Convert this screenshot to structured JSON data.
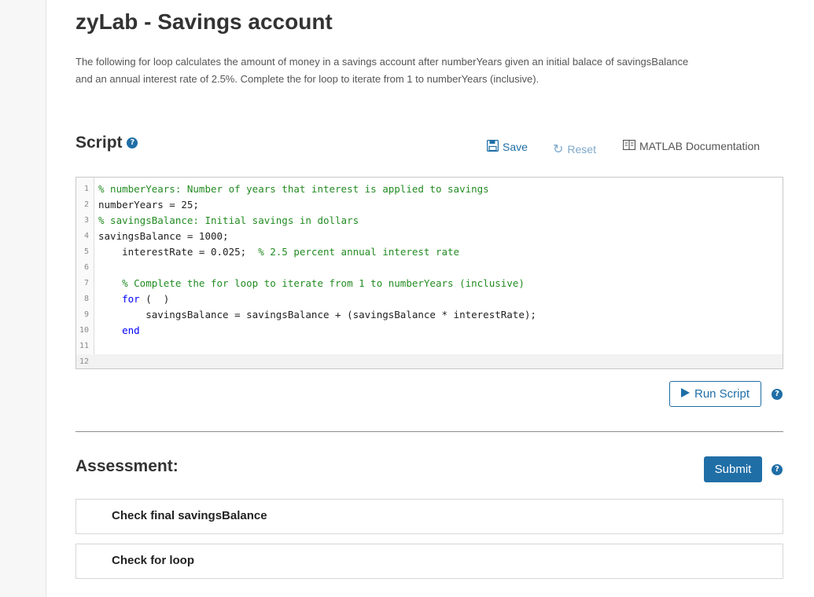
{
  "header": {
    "title": "zyLab - Savings account",
    "description_line1": "The following for loop calculates the amount of money in a savings account after numberYears given an initial balace of savingsBalance",
    "description_line2": "and an annual interest rate of 2.5%. Complete the for loop to iterate from 1 to numberYears (inclusive)."
  },
  "script_section": {
    "heading": "Script",
    "toolbar": {
      "save_label": "Save",
      "reset_label": "Reset",
      "docs_label": "MATLAB Documentation"
    }
  },
  "editor": {
    "lines": [
      {
        "num": "1",
        "text": "% numberYears: Number of years that interest is applied to savings"
      },
      {
        "num": "2",
        "text": "numberYears = 25;"
      },
      {
        "num": "3",
        "text": "% savingsBalance: Initial savings in dollars"
      },
      {
        "num": "4",
        "text": "savingsBalance = 1000;"
      },
      {
        "num": "5",
        "code": "    interestRate = 0.025;  ",
        "comment": "% 2.5 percent annual interest rate"
      },
      {
        "num": "6",
        "text": ""
      },
      {
        "num": "7",
        "text": "    % Complete the for loop to iterate from 1 to numberYears (inclusive)"
      },
      {
        "num": "8",
        "kw": "for",
        "rest": " (  )"
      },
      {
        "num": "9",
        "text": "        savingsBalance = savingsBalance + (savingsBalance * interestRate);"
      },
      {
        "num": "10",
        "text": "end"
      },
      {
        "num": "11",
        "text": ""
      },
      {
        "num": "12",
        "text": ""
      }
    ]
  },
  "run": {
    "label": "Run Script"
  },
  "assessment": {
    "heading": "Assessment:",
    "submit_label": "Submit",
    "tests": [
      {
        "label": "Check final savingsBalance"
      },
      {
        "label": "Check for loop"
      }
    ]
  },
  "icons": {
    "help": "question-circle-icon",
    "save": "floppy-disk-icon",
    "reset": "refresh-icon",
    "docs": "book-icon",
    "run": "play-icon"
  },
  "colors": {
    "accent": "#1f6ea6",
    "comment": "#228b22",
    "keyword": "#0000ff",
    "reset_disabled": "#7fa9cc"
  }
}
